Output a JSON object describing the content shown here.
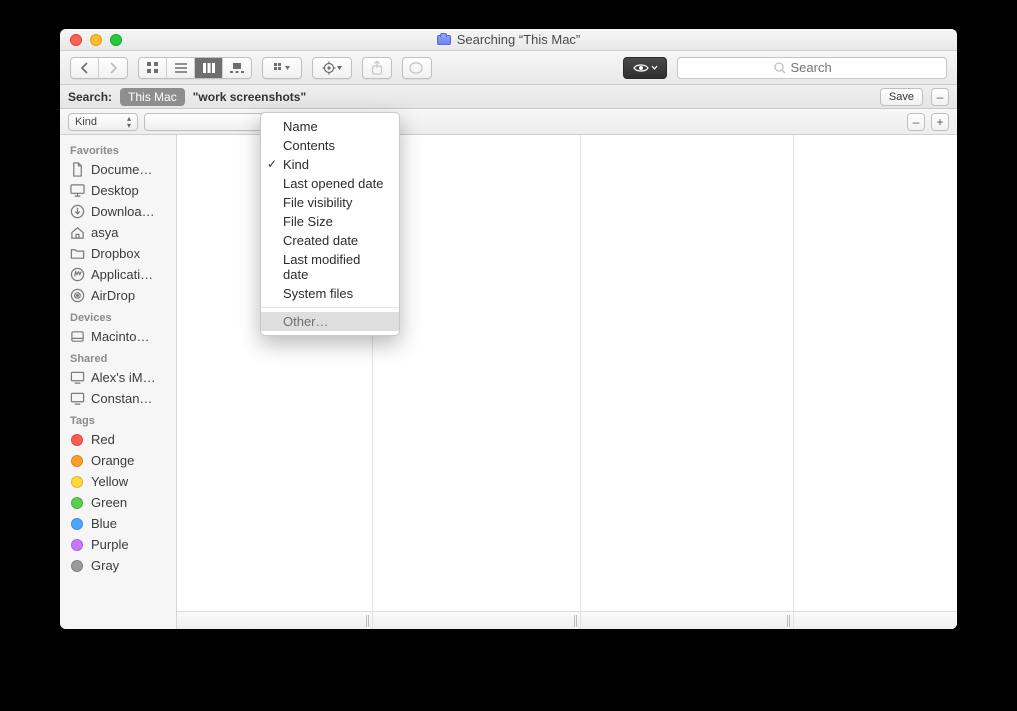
{
  "title": "Searching “This Mac”",
  "toolbar": {
    "search_placeholder": "Search"
  },
  "scope": {
    "label": "Search:",
    "scope_button": "This Mac",
    "query": "\"work screenshots\"",
    "save": "Save"
  },
  "criteria": {
    "attribute": "Kind"
  },
  "attribute_menu": {
    "items": [
      {
        "label": "Name",
        "checked": false
      },
      {
        "label": "Contents",
        "checked": false
      },
      {
        "label": "Kind",
        "checked": true
      },
      {
        "label": "Last opened date",
        "checked": false
      },
      {
        "label": "File visibility",
        "checked": false
      },
      {
        "label": "File Size",
        "checked": false
      },
      {
        "label": "Created date",
        "checked": false
      },
      {
        "label": "Last modified date",
        "checked": false
      },
      {
        "label": "System files",
        "checked": false
      }
    ],
    "other": "Other…"
  },
  "sidebar": {
    "sections": [
      {
        "title": "Favorites",
        "items": [
          {
            "icon": "doc",
            "label": "Docume…"
          },
          {
            "icon": "desktop",
            "label": "Desktop"
          },
          {
            "icon": "download",
            "label": "Downloa…"
          },
          {
            "icon": "home",
            "label": "asya"
          },
          {
            "icon": "folder",
            "label": "Dropbox"
          },
          {
            "icon": "apps",
            "label": "Applicati…"
          },
          {
            "icon": "airdrop",
            "label": "AirDrop"
          }
        ]
      },
      {
        "title": "Devices",
        "items": [
          {
            "icon": "disk",
            "label": "Macinto…"
          }
        ]
      },
      {
        "title": "Shared",
        "items": [
          {
            "icon": "screen",
            "label": "Alex's iM…"
          },
          {
            "icon": "screen",
            "label": "Constan…"
          }
        ]
      },
      {
        "title": "Tags",
        "items": [
          {
            "icon": "tag",
            "color": "#ff5a52",
            "label": "Red"
          },
          {
            "icon": "tag",
            "color": "#ff9e2c",
            "label": "Orange"
          },
          {
            "icon": "tag",
            "color": "#ffd93b",
            "label": "Yellow"
          },
          {
            "icon": "tag",
            "color": "#56d150",
            "label": "Green"
          },
          {
            "icon": "tag",
            "color": "#4aa8ff",
            "label": "Blue"
          },
          {
            "icon": "tag",
            "color": "#c977ff",
            "label": "Purple"
          },
          {
            "icon": "tag",
            "color": "#9a9a9a",
            "label": "Gray"
          }
        ]
      }
    ]
  }
}
